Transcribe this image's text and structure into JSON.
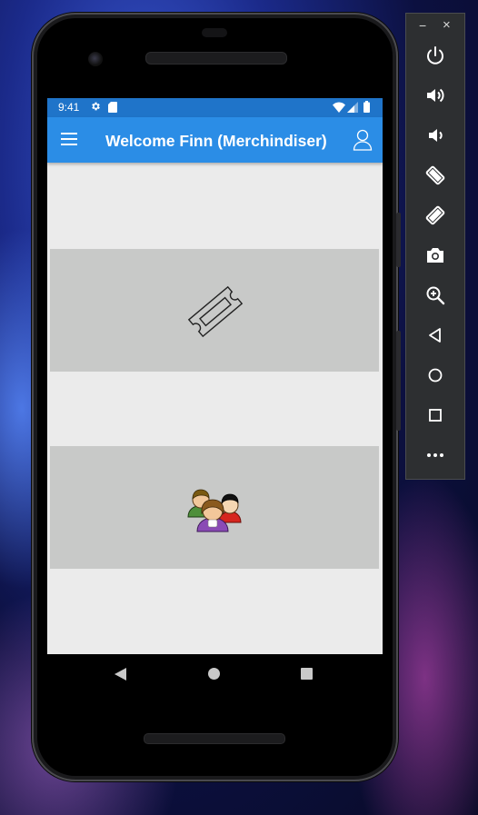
{
  "status": {
    "time": "9:41",
    "icons": [
      "settings-icon",
      "sd-card-icon",
      "wifi-icon",
      "signal-icon",
      "battery-icon"
    ]
  },
  "appbar": {
    "title": "Welcome Finn (Merchindiser)",
    "menu_icon": "hamburger-menu-icon",
    "profile_icon": "user-profile-icon"
  },
  "tiles": [
    {
      "icon": "ticket-icon"
    },
    {
      "icon": "people-group-icon"
    }
  ],
  "navbar": {
    "buttons": [
      "back",
      "home",
      "recents"
    ]
  },
  "emulator_toolbar": {
    "window_controls": [
      "minimize",
      "close"
    ],
    "minimize_glyph": "−",
    "close_glyph": "×",
    "buttons": [
      "power",
      "volume-up",
      "volume-down",
      "rotate-left",
      "rotate-right",
      "screenshot",
      "zoom",
      "back",
      "home",
      "overview",
      "more"
    ]
  },
  "colors": {
    "statusbar": "#1f74c9",
    "appbar": "#2b8de6",
    "screen_bg": "#ebebeb",
    "tile_bg": "#c8c9c8",
    "emulator_panel": "#2d2f31"
  }
}
